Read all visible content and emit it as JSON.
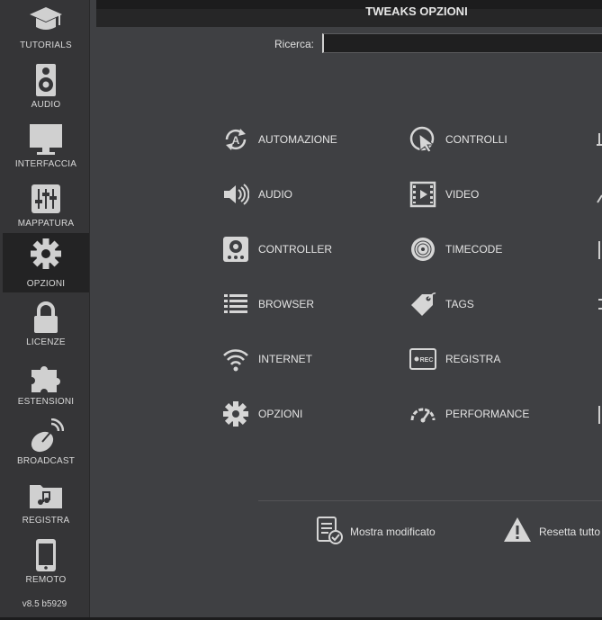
{
  "header": {
    "title": "TWEAKS OPZIONI"
  },
  "search": {
    "label": "Ricerca:",
    "value": ""
  },
  "sidebar": {
    "items": [
      {
        "label": "TUTORIALS",
        "icon": "graduation-cap-icon"
      },
      {
        "label": "AUDIO",
        "icon": "speaker-icon"
      },
      {
        "label": "INTERFACCIA",
        "icon": "monitor-icon"
      },
      {
        "label": "MAPPATURA",
        "icon": "mixer-sliders-icon"
      },
      {
        "label": "OPZIONI",
        "icon": "gear-icon",
        "active": true
      },
      {
        "label": "LICENZE",
        "icon": "lock-icon"
      },
      {
        "label": "ESTENSIONI",
        "icon": "puzzle-icon"
      },
      {
        "label": "BROADCAST",
        "icon": "satellite-dish-icon"
      },
      {
        "label": "REGISTRA",
        "icon": "music-folder-icon"
      },
      {
        "label": "REMOTO",
        "icon": "phone-icon"
      }
    ],
    "version": "v8.5 b5929"
  },
  "categories": {
    "col1": [
      {
        "label": "AUTOMAZIONE",
        "icon": "automation-icon"
      },
      {
        "label": "AUDIO",
        "icon": "volume-icon"
      },
      {
        "label": "CONTROLLER",
        "icon": "controller-icon"
      },
      {
        "label": "BROWSER",
        "icon": "list-icon"
      },
      {
        "label": "INTERNET",
        "icon": "wifi-icon"
      },
      {
        "label": "OPZIONI",
        "icon": "gear-icon"
      }
    ],
    "col2": [
      {
        "label": "CONTROLLI",
        "icon": "cursor-icon"
      },
      {
        "label": "VIDEO",
        "icon": "film-icon"
      },
      {
        "label": "TIMECODE",
        "icon": "vinyl-icon"
      },
      {
        "label": "TAGS",
        "icon": "tag-icon"
      },
      {
        "label": "REGISTRA",
        "icon": "rec-icon"
      },
      {
        "label": "PERFORMANCE",
        "icon": "gauge-icon"
      }
    ]
  },
  "footer": {
    "show_modified": "Mostra modificato",
    "reset_all": "Resetta tutto"
  },
  "colors": {
    "background": "#3f4043",
    "sidebar": "#353537",
    "active": "#232324",
    "text": "#e4e4e4"
  }
}
